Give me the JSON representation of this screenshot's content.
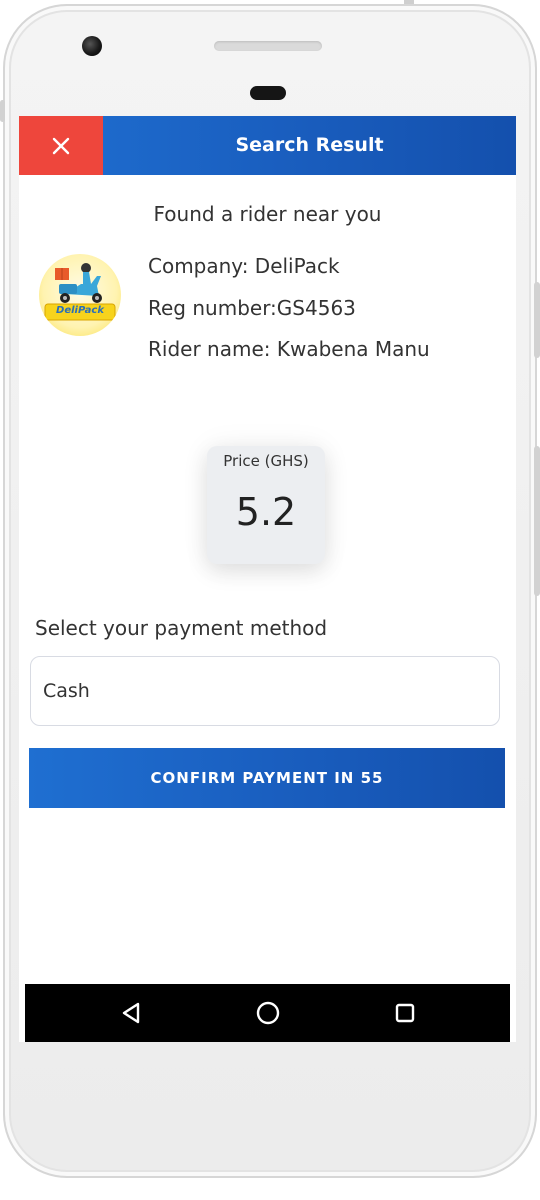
{
  "appbar": {
    "title": "Search Result",
    "close_icon": "close-icon"
  },
  "result": {
    "headline": "Found a rider near you",
    "company": "Company: DeliPack",
    "reg_number": "Reg number:GS4563",
    "rider_name": "Rider name: Kwabena Manu",
    "logo_text": "DeliPack"
  },
  "price": {
    "label": "Price (GHS)",
    "value": "5.2"
  },
  "payment": {
    "label": "Select your payment method",
    "selected_value": "Cash"
  },
  "confirm_button": {
    "label": "CONFIRM PAYMENT IN 55"
  },
  "nav": {
    "back_icon": "back-triangle-icon",
    "home_icon": "home-circle-icon",
    "recents_icon": "recents-square-icon"
  },
  "colors": {
    "primary_blue": "#1a5fc0",
    "close_red": "#ee463c",
    "nav_black": "#000000"
  }
}
